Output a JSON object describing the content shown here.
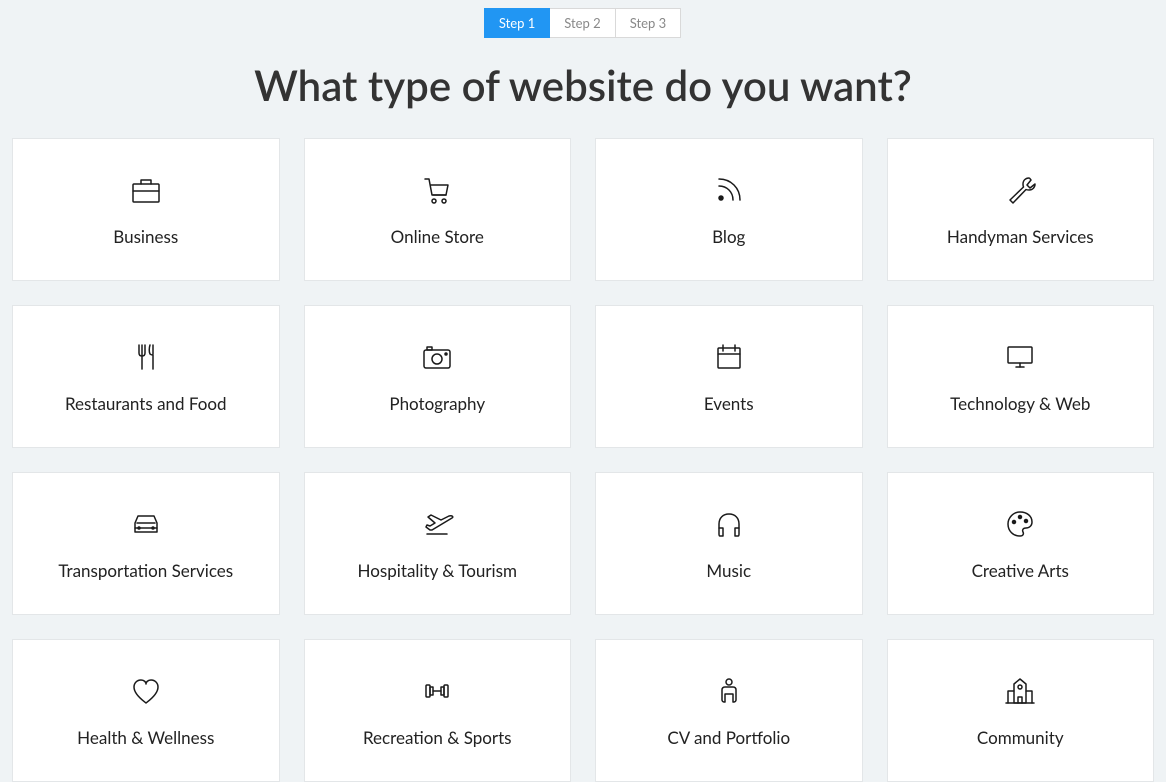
{
  "steps": [
    {
      "label": "Step 1",
      "active": true
    },
    {
      "label": "Step 2",
      "active": false
    },
    {
      "label": "Step 3",
      "active": false
    }
  ],
  "title": "What type of website do you want?",
  "categories": [
    {
      "label": "Business",
      "icon": "briefcase-icon"
    },
    {
      "label": "Online Store",
      "icon": "cart-icon"
    },
    {
      "label": "Blog",
      "icon": "rss-icon"
    },
    {
      "label": "Handyman Services",
      "icon": "wrench-icon"
    },
    {
      "label": "Restaurants and Food",
      "icon": "utensils-icon"
    },
    {
      "label": "Photography",
      "icon": "camera-icon"
    },
    {
      "label": "Events",
      "icon": "calendar-icon"
    },
    {
      "label": "Technology & Web",
      "icon": "monitor-icon"
    },
    {
      "label": "Transportation Services",
      "icon": "car-icon"
    },
    {
      "label": "Hospitality & Tourism",
      "icon": "plane-icon"
    },
    {
      "label": "Music",
      "icon": "headphones-icon"
    },
    {
      "label": "Creative Arts",
      "icon": "palette-icon"
    },
    {
      "label": "Health & Wellness",
      "icon": "heart-icon"
    },
    {
      "label": "Recreation & Sports",
      "icon": "dumbbell-icon"
    },
    {
      "label": "CV and Portfolio",
      "icon": "person-icon"
    },
    {
      "label": "Community",
      "icon": "building-icon"
    }
  ]
}
